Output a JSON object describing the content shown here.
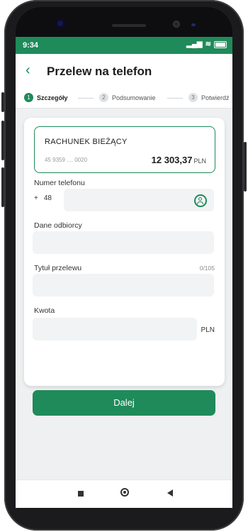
{
  "status_bar": {
    "time": "9:34",
    "signal": "▂▄▆",
    "wifi": "≋"
  },
  "header": {
    "back_icon": "‹",
    "title": "Przelew na telefon"
  },
  "steps": [
    {
      "number": "1",
      "label": "Szczegóły",
      "active": true
    },
    {
      "number": "2",
      "label": "Podsumowanie",
      "active": false
    },
    {
      "number": "3",
      "label": "Potwierdź",
      "active": false
    }
  ],
  "account": {
    "name": "RACHUNEK BIEŻĄCY",
    "number": "45 9359 .... 0020",
    "balance": "12 303,37",
    "currency": "PLN"
  },
  "form": {
    "phone_label": "Numer telefonu",
    "phone_prefix_plus": "+",
    "phone_prefix_code": "48",
    "recipient_label": "Dane odbiorcy",
    "title_label": "Tytuł przelewu",
    "title_counter": "0/105",
    "amount_label": "Kwota",
    "amount_currency": "PLN"
  },
  "button": {
    "next_label": "Dalej"
  },
  "colors": {
    "brand_green": "#1f8a5a"
  },
  "icons": {
    "contact": "contact-icon",
    "back": "chevron-left-icon"
  }
}
